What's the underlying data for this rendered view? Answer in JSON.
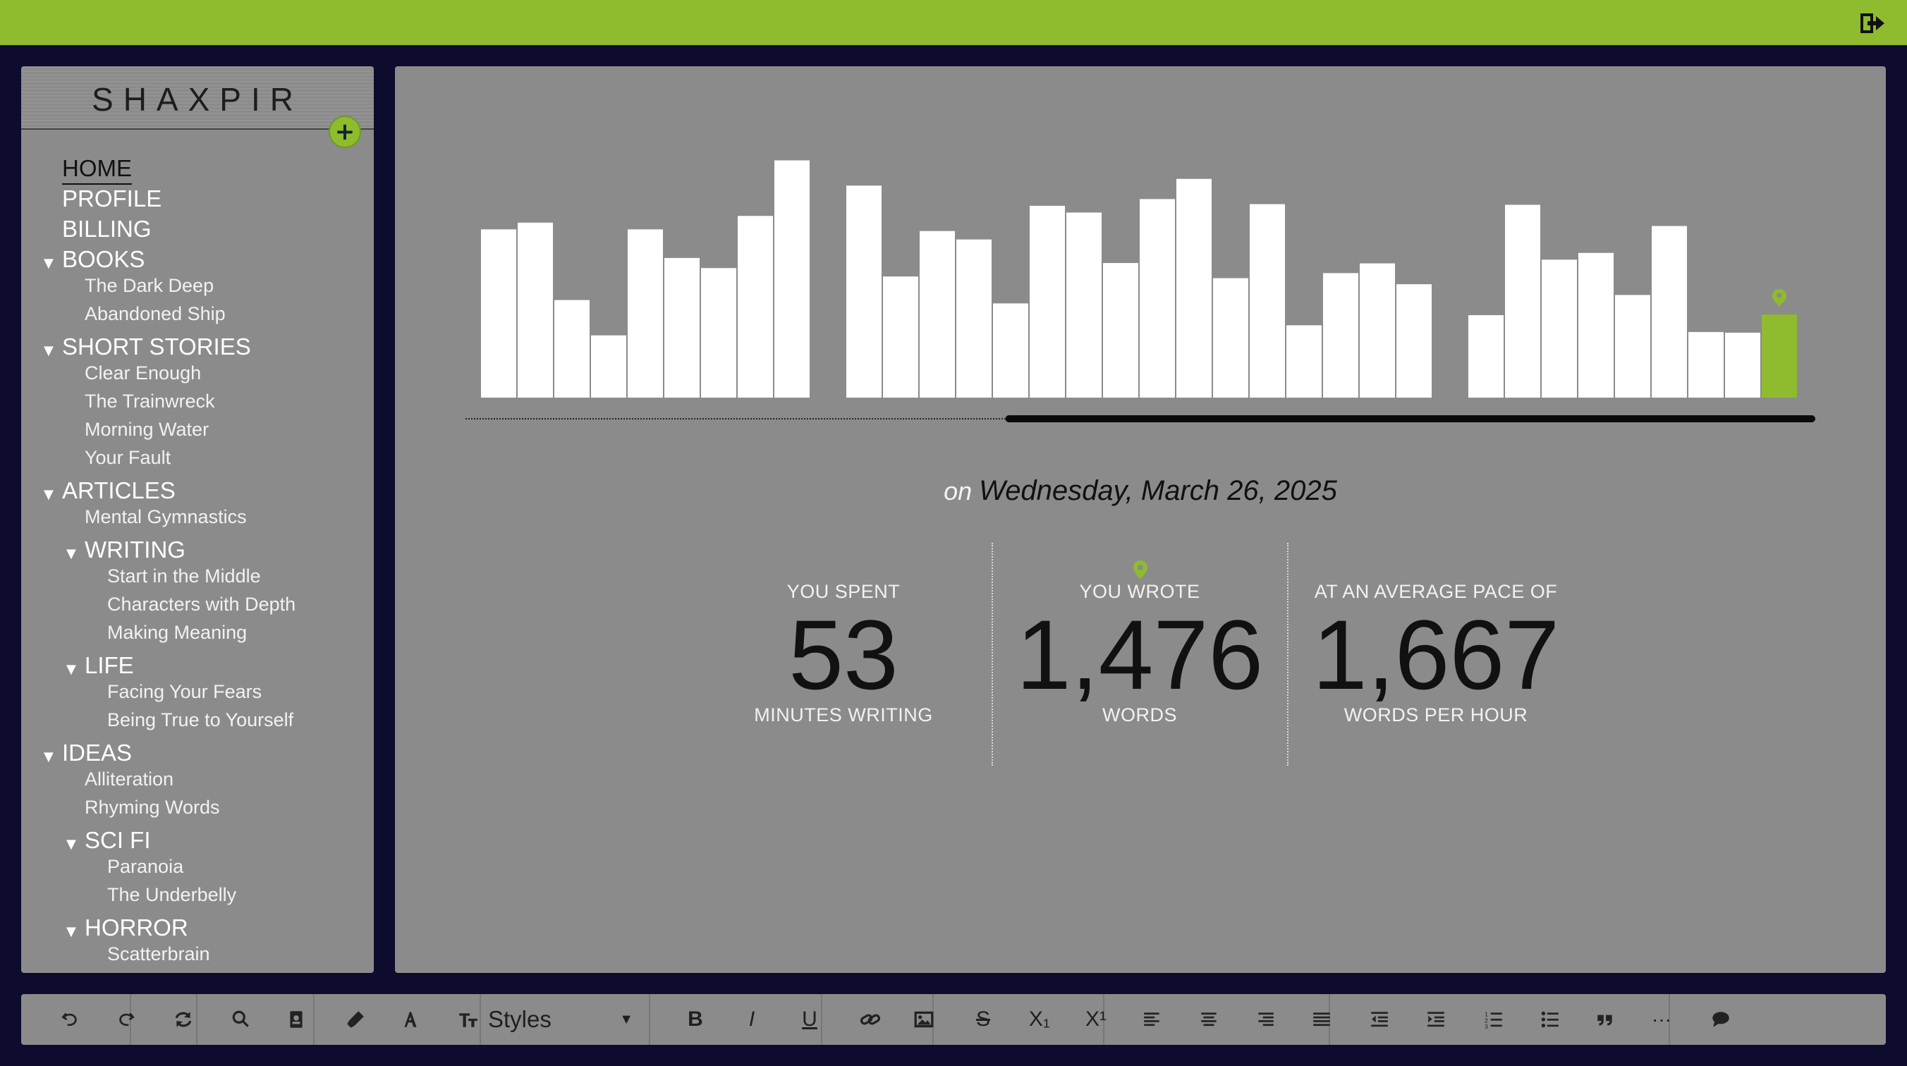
{
  "app": {
    "brand": "SHAXPIR",
    "colors": {
      "accent": "#8fbb2f",
      "background": "#0d0b2e",
      "panel": "#8b8b8b",
      "bar": "#ffffff"
    },
    "icons": {
      "logout": "logout-icon",
      "add": "plus-icon"
    },
    "add_label": "+"
  },
  "sidebar": {
    "items": [
      {
        "label": "HOME",
        "level": 0,
        "active": true
      },
      {
        "label": "PROFILE",
        "level": 0
      },
      {
        "label": "BILLING",
        "level": 0
      },
      {
        "label": "BOOKS",
        "level": 0,
        "expanded": true
      },
      {
        "label": "The Dark Deep",
        "level": 1
      },
      {
        "label": "Abandoned Ship",
        "level": 1
      },
      {
        "label": "SHORT STORIES",
        "level": 0,
        "expanded": true
      },
      {
        "label": "Clear Enough",
        "level": 1
      },
      {
        "label": "The Trainwreck",
        "level": 1
      },
      {
        "label": "Morning Water",
        "level": 1
      },
      {
        "label": "Your Fault",
        "level": 1
      },
      {
        "label": "ARTICLES",
        "level": 0,
        "expanded": true
      },
      {
        "label": "Mental Gymnastics",
        "level": 1
      },
      {
        "label": "WRITING",
        "level": 1,
        "folder": true,
        "expanded": true
      },
      {
        "label": "Start in the Middle",
        "level": 2
      },
      {
        "label": "Characters with Depth",
        "level": 2
      },
      {
        "label": "Making Meaning",
        "level": 2
      },
      {
        "label": "LIFE",
        "level": 1,
        "folder": true,
        "expanded": true
      },
      {
        "label": "Facing Your Fears",
        "level": 2
      },
      {
        "label": "Being True to Yourself",
        "level": 2
      },
      {
        "label": "IDEAS",
        "level": 0,
        "expanded": true
      },
      {
        "label": "Alliteration",
        "level": 1
      },
      {
        "label": "Rhyming Words",
        "level": 1
      },
      {
        "label": "SCI FI",
        "level": 1,
        "folder": true,
        "expanded": true
      },
      {
        "label": "Paranoia",
        "level": 2
      },
      {
        "label": "The Underbelly",
        "level": 2
      },
      {
        "label": "HORROR",
        "level": 1,
        "folder": true,
        "expanded": true
      },
      {
        "label": "Scatterbrain",
        "level": 2
      }
    ]
  },
  "chart_data": {
    "type": "bar",
    "groups": [
      {
        "values": [
          5.0,
          5.2,
          2.9,
          1.85,
          5.0,
          4.15,
          3.85,
          5.4,
          7.05
        ]
      },
      {
        "values": [
          6.3,
          3.6,
          4.95,
          4.7,
          2.8,
          5.7,
          5.5,
          4.0,
          5.9,
          6.5,
          3.55,
          5.75,
          2.15,
          3.7,
          3.99,
          3.37
        ]
      },
      {
        "values": [
          2.45,
          5.73,
          4.1,
          4.3,
          3.05,
          5.1,
          1.95,
          1.93,
          2.47
        ]
      }
    ],
    "highlight": {
      "group": 2,
      "index": 8,
      "color": "#8fbb2f"
    },
    "ylim": [
      0,
      7.5
    ],
    "scroll_range": [
      0.4,
      1.0
    ]
  },
  "summary": {
    "date_prefix": "on",
    "date": "Wednesday, March 26, 2025",
    "stats": [
      {
        "top": "YOU SPENT",
        "value": "53",
        "bottom": "MINUTES WRITING"
      },
      {
        "top": "YOU WROTE",
        "value": "1,476",
        "bottom": "WORDS",
        "pin": true
      },
      {
        "top": "AT AN AVERAGE PACE OF",
        "value": "1,667",
        "bottom": "WORDS PER HOUR"
      }
    ]
  },
  "toolbar": {
    "styles_label": "Styles",
    "buttons": [
      {
        "name": "undo",
        "icon": "undo-icon"
      },
      {
        "name": "redo",
        "icon": "redo-icon"
      },
      {
        "name": "sync",
        "icon": "sync-icon"
      },
      {
        "name": "search",
        "icon": "search-icon"
      },
      {
        "name": "dictionary",
        "icon": "book-icon"
      },
      {
        "name": "highlight",
        "icon": "highlighter-icon"
      },
      {
        "name": "font-color",
        "icon": "font-color-icon"
      },
      {
        "name": "font-size",
        "icon": "text-size-icon"
      },
      {
        "name": "bold",
        "icon": "bold-icon",
        "glyph": "B"
      },
      {
        "name": "italic",
        "icon": "italic-icon",
        "glyph": "I"
      },
      {
        "name": "underline",
        "icon": "underline-icon",
        "glyph": "U"
      },
      {
        "name": "link",
        "icon": "link-icon"
      },
      {
        "name": "image",
        "icon": "image-icon"
      },
      {
        "name": "strikethrough",
        "icon": "strikethrough-icon",
        "glyph": "S"
      },
      {
        "name": "subscript",
        "icon": "subscript-icon",
        "glyph": "X₁"
      },
      {
        "name": "superscript",
        "icon": "superscript-icon",
        "glyph": "X¹"
      },
      {
        "name": "align-left",
        "icon": "align-left-icon"
      },
      {
        "name": "align-center",
        "icon": "align-center-icon"
      },
      {
        "name": "align-right",
        "icon": "align-right-icon"
      },
      {
        "name": "align-justify",
        "icon": "align-justify-icon"
      },
      {
        "name": "outdent",
        "icon": "outdent-icon"
      },
      {
        "name": "indent",
        "icon": "indent-icon"
      },
      {
        "name": "ordered-list",
        "icon": "ordered-list-icon"
      },
      {
        "name": "bullet-list",
        "icon": "bullet-list-icon"
      },
      {
        "name": "blockquote",
        "icon": "quote-icon"
      },
      {
        "name": "more",
        "icon": "more-icon",
        "glyph": "···"
      },
      {
        "name": "comment",
        "icon": "comment-icon"
      }
    ]
  }
}
